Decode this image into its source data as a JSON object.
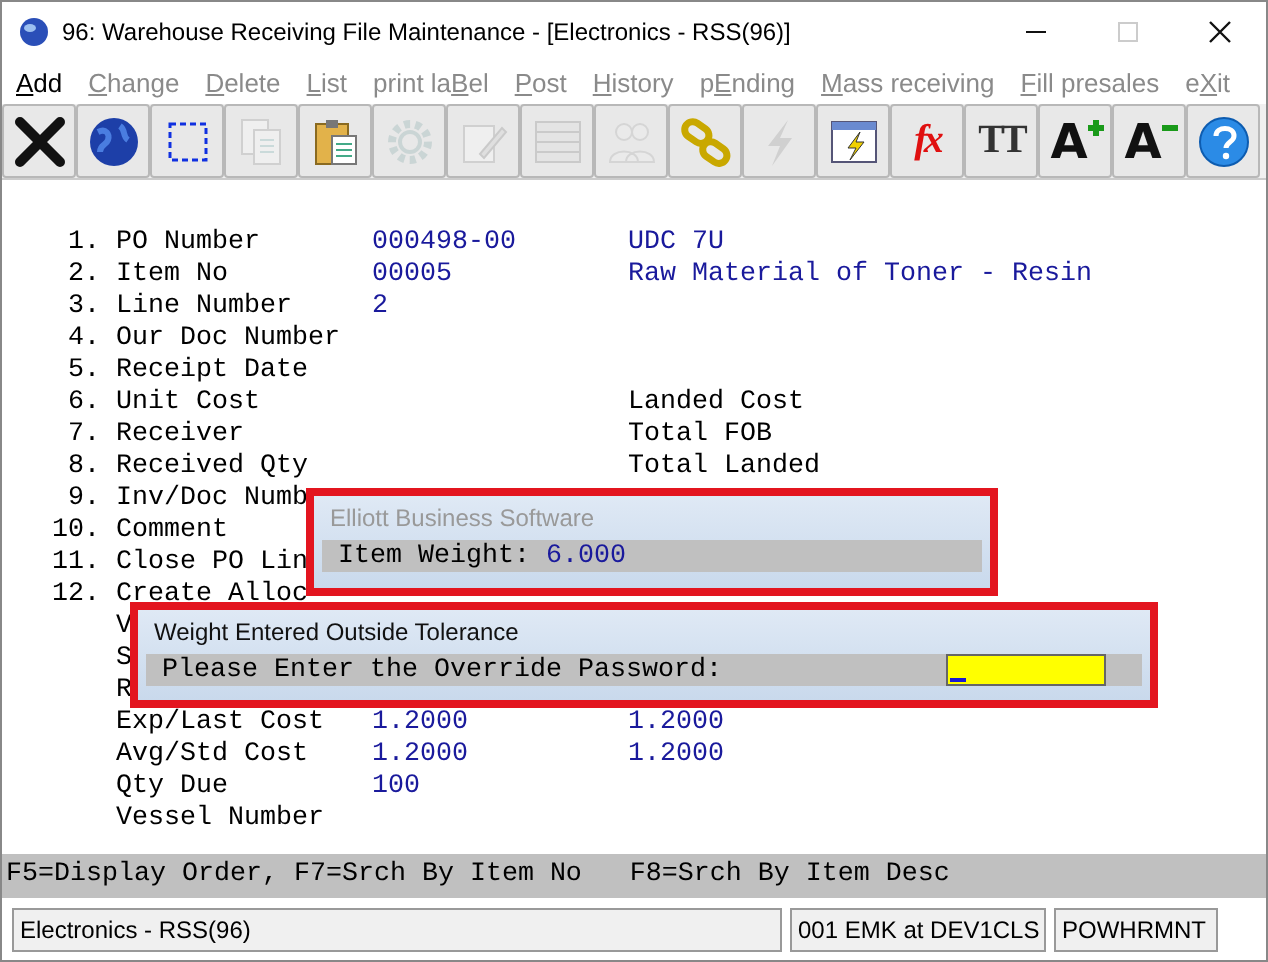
{
  "window": {
    "title": "96: Warehouse Receiving File Maintenance - [Electronics - RSS(96)]",
    "controls": [
      {
        "kind": "minimize",
        "disabled": false
      },
      {
        "kind": "maximize",
        "disabled": true
      },
      {
        "kind": "close",
        "disabled": false
      }
    ]
  },
  "menu": [
    {
      "key": "A",
      "after": "dd",
      "disabled": false
    },
    {
      "key": "C",
      "after": "hange",
      "disabled": true
    },
    {
      "key": "D",
      "after": "elete",
      "disabled": true
    },
    {
      "key": "L",
      "after": "ist",
      "disabled": true
    },
    {
      "before": "print la",
      "key": "B",
      "after": "el",
      "disabled": true
    },
    {
      "key": "P",
      "after": "ost",
      "disabled": true
    },
    {
      "key": "H",
      "after": "istory",
      "disabled": true
    },
    {
      "before": "p",
      "key": "E",
      "after": "nding",
      "disabled": true
    },
    {
      "key": "M",
      "after": "ass receiving",
      "disabled": true
    },
    {
      "key": "F",
      "after": "ill presales",
      "disabled": true
    },
    {
      "before": "e",
      "key": "X",
      "after": "it",
      "disabled": true
    }
  ],
  "toolbar": [
    {
      "kind": "cancel",
      "disabled": false
    },
    {
      "kind": "globe",
      "disabled": false
    },
    {
      "kind": "select",
      "disabled": false
    },
    {
      "kind": "copy",
      "disabled": true
    },
    {
      "kind": "paste",
      "disabled": false
    },
    {
      "kind": "gear",
      "disabled": true
    },
    {
      "kind": "edit",
      "disabled": true
    },
    {
      "kind": "table",
      "disabled": true
    },
    {
      "kind": "people",
      "disabled": true
    },
    {
      "kind": "link",
      "disabled": false
    },
    {
      "kind": "lightning",
      "disabled": true
    },
    {
      "kind": "spreadsheet",
      "disabled": false
    },
    {
      "kind": "text",
      "glyph": "fx",
      "disabled": false
    },
    {
      "kind": "text",
      "glyph": "TT",
      "disabled": false
    },
    {
      "kind": "font-up",
      "glyph": "A",
      "disabled": false
    },
    {
      "kind": "font-down",
      "glyph": "A",
      "disabled": false
    },
    {
      "kind": "help",
      "disabled": false
    }
  ],
  "fields": [
    {
      "number": "1.",
      "label": "PO Number",
      "value": "000498-00",
      "extra": "UDC 7U"
    },
    {
      "number": "2.",
      "label": "Item No",
      "value": "00005",
      "extra": "Raw Material of Toner - Resin"
    },
    {
      "number": "3.",
      "label": "Line Number",
      "value": "2"
    },
    {
      "number": "4.",
      "label": "Our Doc Number"
    },
    {
      "number": "5.",
      "label": "Receipt Date"
    },
    {
      "number": "6.",
      "label": "Unit Cost",
      "extra": "Landed Cost"
    },
    {
      "number": "7.",
      "label": "Receiver",
      "extra": "Total FOB"
    },
    {
      "number": "8.",
      "label": "Received Qty",
      "extra": "Total Landed"
    },
    {
      "number": "9.",
      "label": "Inv/Doc Numb"
    },
    {
      "number": "10.",
      "label": "Comment"
    },
    {
      "number": "11.",
      "label": "Close PO Lin"
    },
    {
      "number": "12.",
      "label": "Create Alloc"
    },
    {
      "label": "V"
    },
    {
      "label": "S"
    },
    {
      "label": "R"
    },
    {
      "label": "Exp/Last Cost",
      "value": "1.2000",
      "extra": "1.2000"
    },
    {
      "label": "Avg/Std Cost",
      "value": "1.2000",
      "extra": "1.2000"
    },
    {
      "label": "Qty Due",
      "value": "100"
    },
    {
      "label": "Vessel Number"
    }
  ],
  "info_dialog": {
    "title": "Elliott Business Software",
    "label": "Item Weight:",
    "value": "6.000"
  },
  "password_dialog": {
    "title": "Weight Entered Outside Tolerance",
    "prompt": "Please Enter the Override Password:"
  },
  "function_keys": "F5=Display Order, F7=Srch By Item No   F8=Srch By Item Desc",
  "status_bar": [
    "Electronics - RSS(96)",
    "001 EMK at DEV1CLS",
    "POWHRMNT"
  ]
}
